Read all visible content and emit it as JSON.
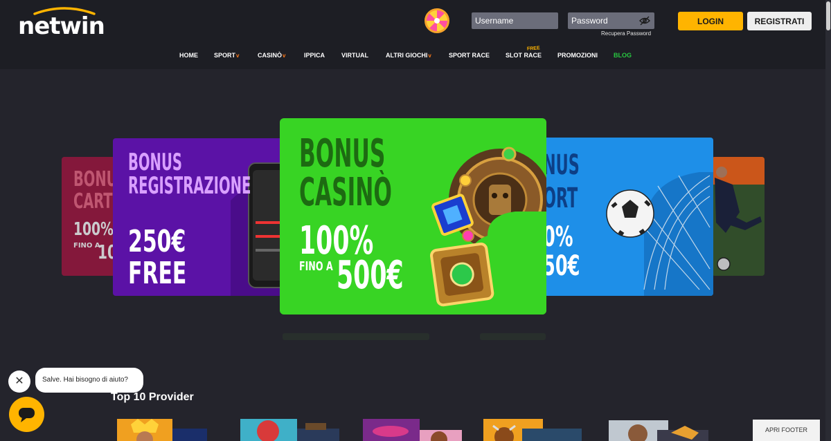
{
  "header": {
    "logo": "netwin",
    "username_placeholder": "Username",
    "password_placeholder": "Password",
    "recover_password": "Recupera Password",
    "login_label": "LOGIN",
    "register_label": "REGISTRATI"
  },
  "nav": {
    "items": [
      "HOME",
      "SPORT",
      "CASINÒ",
      "IPPICA",
      "VIRTUAL",
      "ALTRI GIOCHI",
      "SPORT RACE",
      "SLOT RACE",
      "PROMOZIONI",
      "BLOG"
    ],
    "dropdown_marker": "v",
    "free_badge": "FREE"
  },
  "banners": {
    "far_left": {
      "title1": "BONU",
      "title2": "CART",
      "value1": "100%",
      "value2": "FINO A",
      "value3": "10"
    },
    "left": {
      "title1": "BONUS",
      "title2": "REGISTRAZIONE",
      "value1": "250€",
      "value2": "FREE"
    },
    "center": {
      "title1": "BONUS",
      "title2": "CASINÒ",
      "value1": "100%",
      "value2": "FINO A",
      "value3": "500€"
    },
    "right": {
      "title1": "NUS",
      "title2": "ORT",
      "value1": "0%",
      "value2": "50€"
    }
  },
  "section": {
    "top_providers": "Top 10 Provider"
  },
  "chat": {
    "close": "✕",
    "message": "Salve. Hai bisogno di aiuto?"
  },
  "footer": {
    "open_footer": "APRI FOOTER"
  },
  "colors": {
    "accent": "#ffb400",
    "header_bg": "#1d1e24",
    "page_bg": "#24242c",
    "blog": "#28c840"
  }
}
